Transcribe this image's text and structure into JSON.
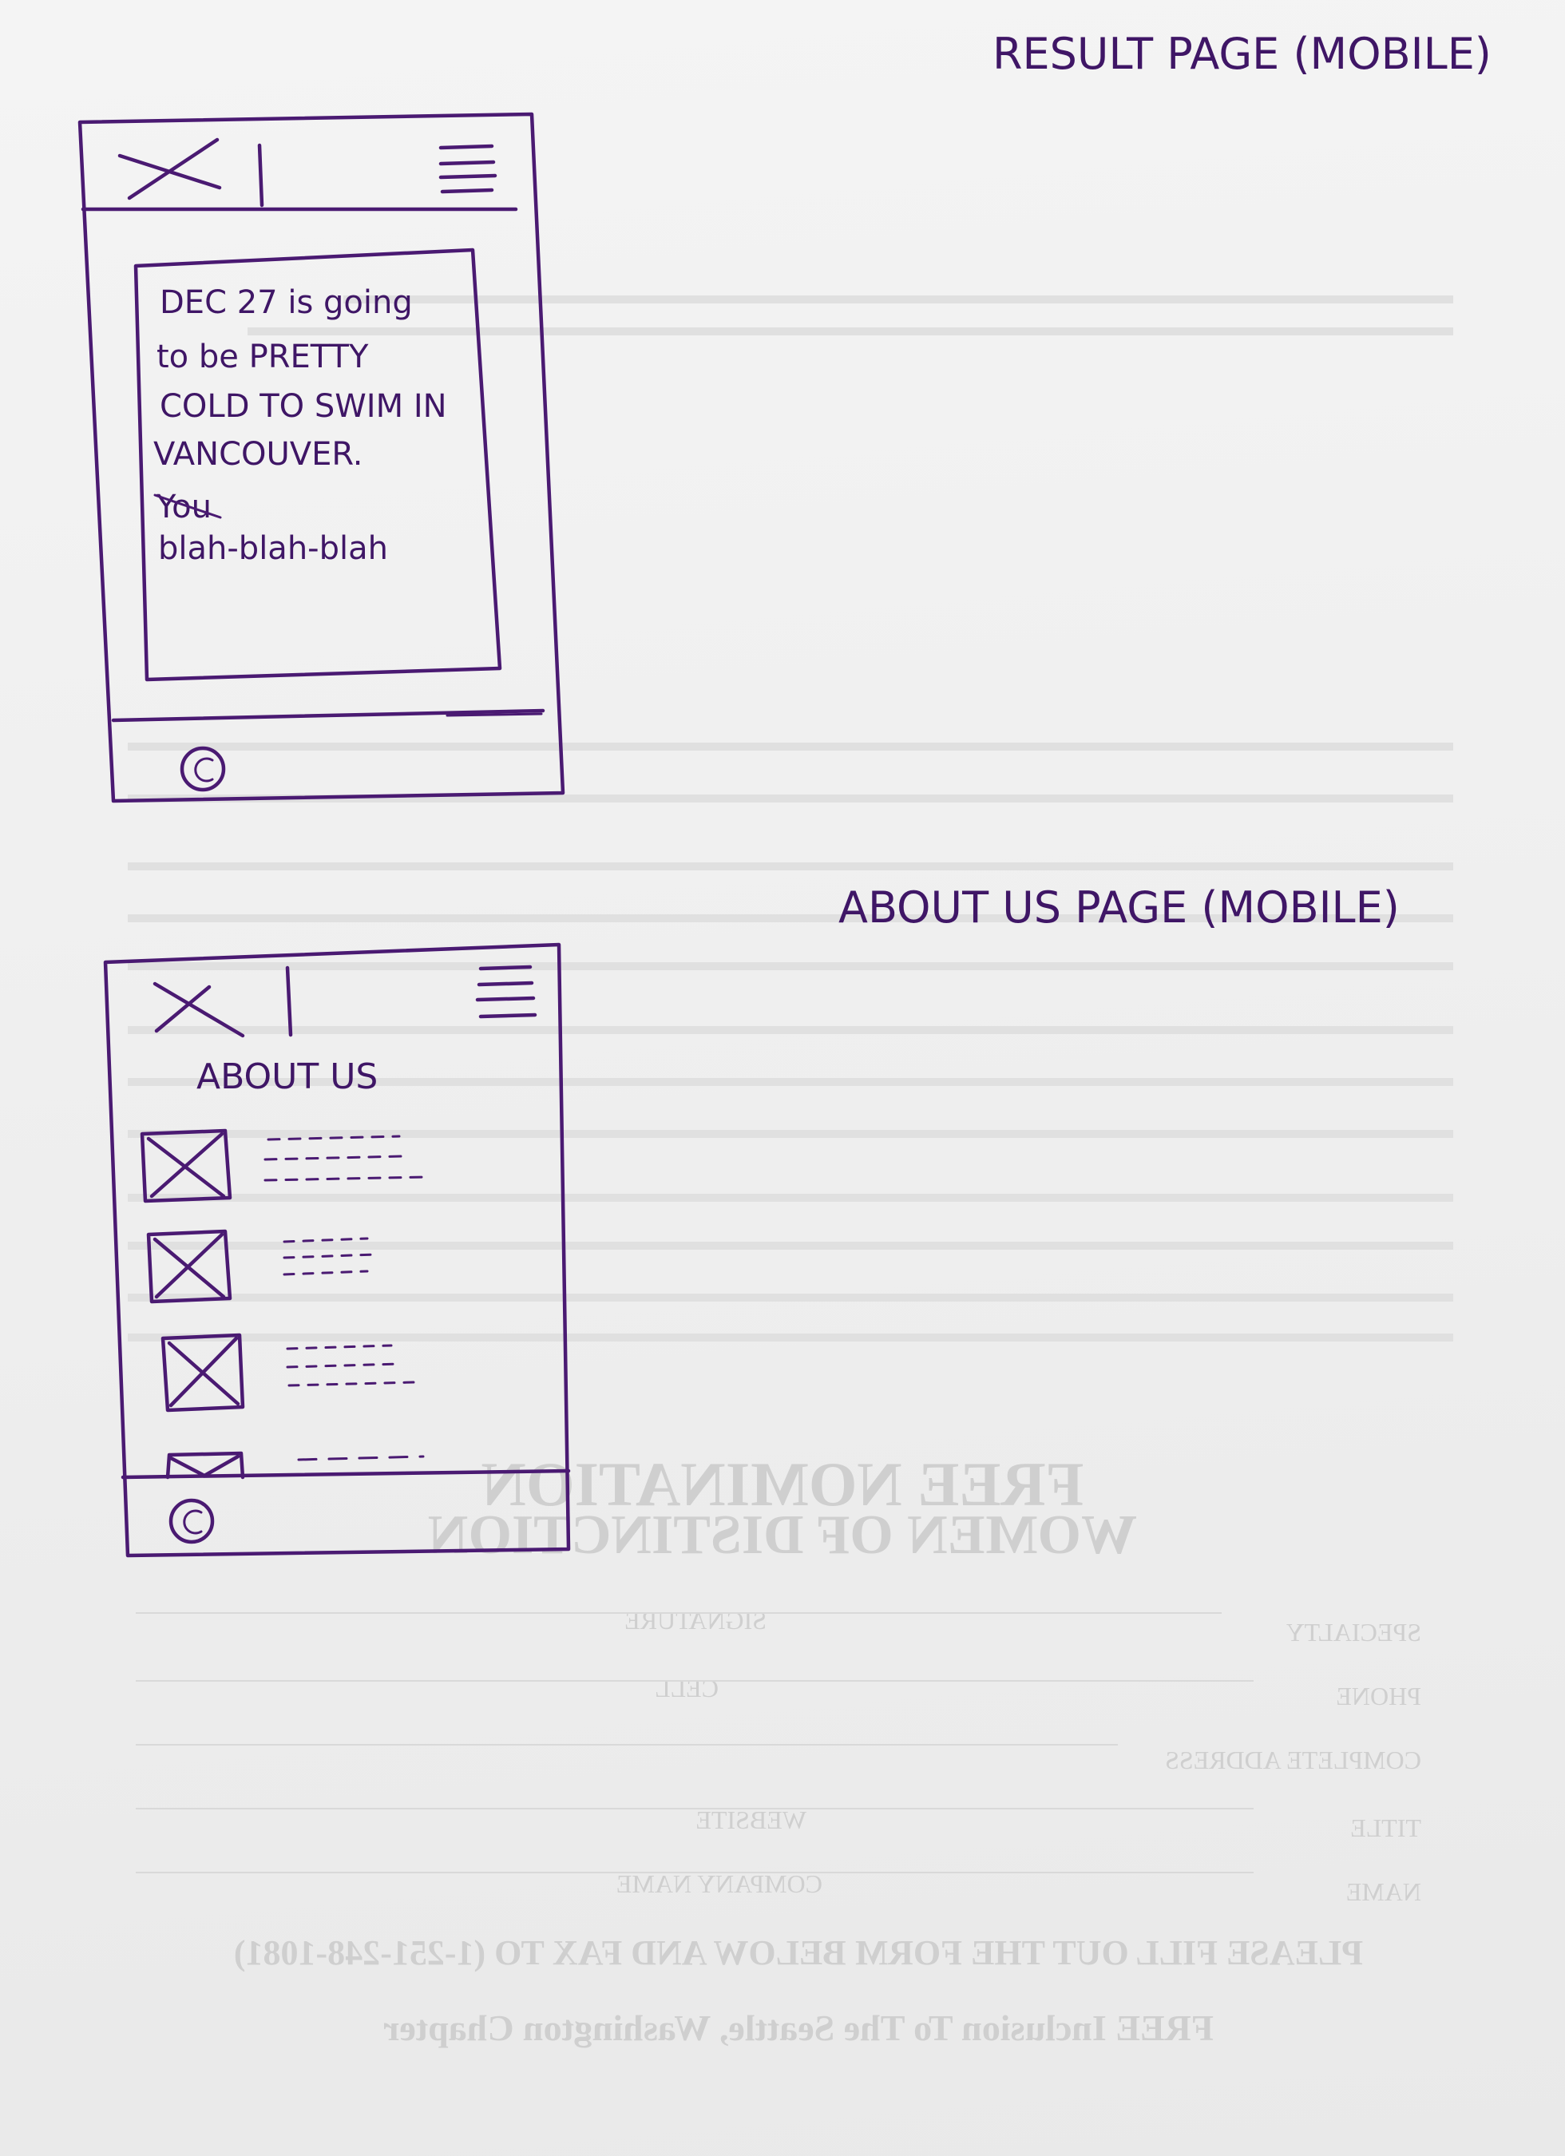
{
  "annotations": {
    "result_page": "RESULT PAGE (MOBILE)",
    "about_page": "ABOUT US PAGE (MOBILE)"
  },
  "result_screen": {
    "logo_icon": "x-placeholder-icon",
    "menu_icon": "hamburger-menu-icon",
    "message_lines": [
      "DEC 27 is going",
      "to be PRETTY",
      "COLD TO SWIM IN",
      "VANCOUVER.",
      "You",
      "blah-blah-blah"
    ],
    "footer_symbol": "©"
  },
  "about_screen": {
    "logo_icon": "x-placeholder-icon",
    "menu_icon": "hamburger-menu-icon",
    "title": "ABOUT US",
    "list_items": [
      "image-placeholder",
      "image-placeholder",
      "image-placeholder",
      "image-placeholder"
    ],
    "footer_symbol": "©"
  },
  "background_print": {
    "lines": [
      "FREE Inclusion To The Seattle, Washington Chapter",
      "PLEASE FILL OUT THE FORM BELOW AND FAX TO (1-251-248-1081)",
      "NAME",
      "COMPANY NAME",
      "TITLE",
      "WEBSITE",
      "COMPLETE ADDRESS",
      "PHONE",
      "CELL",
      "SPECIALTY",
      "SIGNATURE",
      "WOMEN OF DISTINCTION",
      "FREE NOMINATION"
    ]
  }
}
